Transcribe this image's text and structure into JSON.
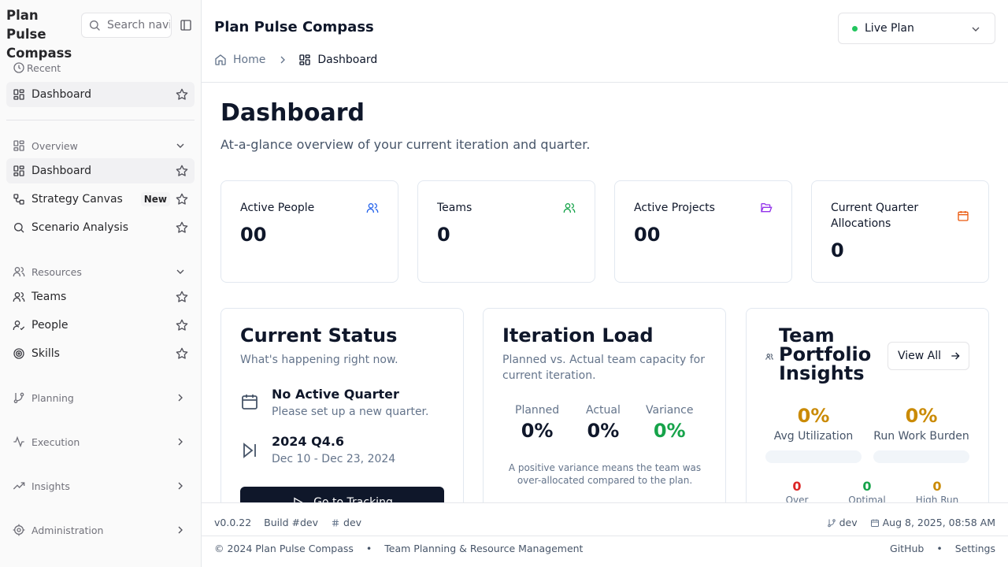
{
  "app": {
    "name": "Plan Pulse Compass",
    "brand": "Plan Pulse Compass"
  },
  "sidebar": {
    "search_placeholder": "Search navigation",
    "recent_label": "Recent",
    "recent_items": [
      {
        "label": "Dashboard",
        "icon": "layout-dashboard-icon"
      }
    ],
    "groups": {
      "overview": {
        "label": "Overview",
        "expanded": true,
        "items": [
          {
            "label": "Dashboard",
            "icon": "layout-dashboard-icon",
            "active": true
          },
          {
            "label": "Strategy Canvas",
            "icon": "workflow-icon",
            "badge": "New"
          },
          {
            "label": "Scenario Analysis",
            "icon": "search-icon"
          }
        ]
      },
      "resources": {
        "label": "Resources",
        "expanded": true,
        "items": [
          {
            "label": "Teams",
            "icon": "users-icon"
          },
          {
            "label": "People",
            "icon": "user-check-icon"
          },
          {
            "label": "Skills",
            "icon": "target-icon"
          }
        ]
      },
      "planning": {
        "label": "Planning",
        "expanded": false
      },
      "execution": {
        "label": "Execution",
        "expanded": false
      },
      "insights": {
        "label": "Insights",
        "expanded": false
      },
      "administration": {
        "label": "Administration",
        "expanded": false
      }
    }
  },
  "header": {
    "title": "Plan Pulse Compass",
    "plan_select": {
      "value": "Live Plan",
      "status_color": "#22c55e"
    },
    "breadcrumbs": [
      {
        "label": "Home"
      },
      {
        "label": "Dashboard"
      }
    ]
  },
  "main": {
    "title": "Dashboard",
    "subtitle": "At-a-glance overview of your current iteration and quarter.",
    "stats": [
      {
        "label": "Active People",
        "value": "00",
        "icon": "users-icon",
        "color": "#2563eb"
      },
      {
        "label": "Teams",
        "value": "0",
        "icon": "users-icon",
        "color": "#16a34a"
      },
      {
        "label": "Active Projects",
        "value": "00",
        "icon": "folder-open-icon",
        "color": "#9333ea"
      },
      {
        "label": "Current Quarter Allocations",
        "value": "0",
        "icon": "calendar-icon",
        "color": "#ea580c"
      }
    ],
    "current_status": {
      "title": "Current Status",
      "subtitle": "What's happening right now.",
      "quarter": {
        "title": "No Active Quarter",
        "subtitle": "Please set up a new quarter."
      },
      "iteration": {
        "title": "2024 Q4.6",
        "subtitle": "Dec 10 - Dec 23, 2024"
      },
      "button": "Go to Tracking"
    },
    "iteration_load": {
      "title": "Iteration Load",
      "subtitle": "Planned vs. Actual team capacity for current iteration.",
      "planned": {
        "label": "Planned",
        "value": "0%"
      },
      "actual": {
        "label": "Actual",
        "value": "0%"
      },
      "variance": {
        "label": "Variance",
        "value": "0%",
        "color": "#16a34a"
      },
      "note": "A positive variance means the team was over-allocated compared to the plan."
    },
    "team_portfolio": {
      "title": "Team Portfolio Insights",
      "view_all": "View All",
      "avg_utilization": {
        "label": "Avg Utilization",
        "value": "0%",
        "fill": 0
      },
      "run_work_burden": {
        "label": "Run Work Burden",
        "value": "0%",
        "fill": 0
      },
      "counts": [
        {
          "label": "Over",
          "value": "0",
          "color": "#dc2626"
        },
        {
          "label": "Optimal Run",
          "value": "0",
          "color": "#16a34a"
        },
        {
          "label": "High Run",
          "value": "0",
          "color": "#ca8a04"
        }
      ]
    }
  },
  "footer": {
    "version": "v0.0.22",
    "build": "Build #dev",
    "branch_tag": "dev",
    "git_branch": "dev",
    "timestamp": "Aug 8, 2025, 08:58 AM",
    "copyright": "© 2024 Plan Pulse Compass",
    "bullet": "•",
    "tagline": "Team Planning & Resource Management",
    "links": {
      "github": "GitHub",
      "settings": "Settings"
    }
  }
}
